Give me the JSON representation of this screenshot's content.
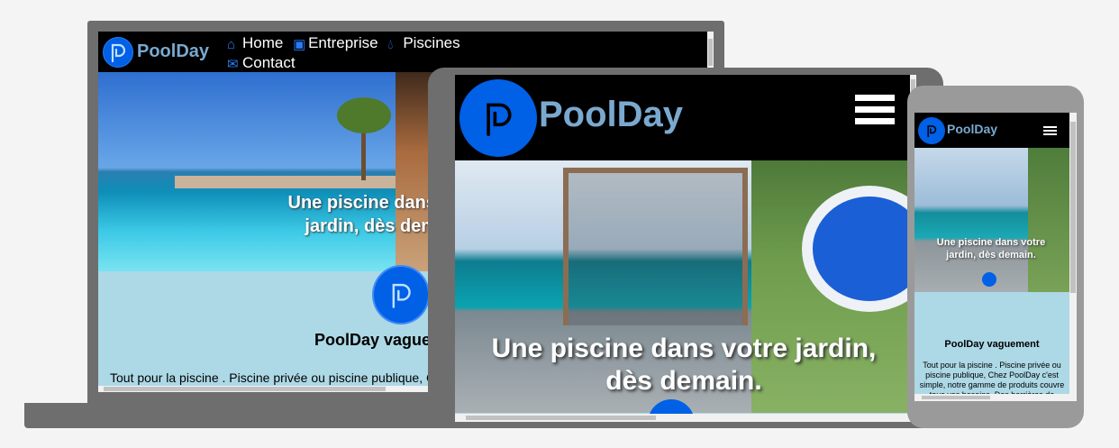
{
  "brand": "PoolDay",
  "nav": {
    "home": "Home",
    "entreprise": "Entreprise",
    "piscines": "Piscines",
    "contact": "Contact"
  },
  "hero": {
    "laptop_text": "Une piscine dans votre jardin, dès demain.",
    "tablet_text": "Une piscine dans votre jardin, dès demain.",
    "phone_text": "Une piscine dans votre jardin, dès demain."
  },
  "section": {
    "heading": "PoolDay vaguement",
    "body": "Tout pour la piscine . Piscine privée ou piscine publique, Chez PoolDay c'est simple, notre gamme de produits couvre tous vos besoins. Des barrières de"
  },
  "colors": {
    "accent_blue": "#0060e6",
    "brand_text": "#7aa9cf",
    "content_bg": "#add8e6",
    "nav_bg": "#000000",
    "device_frame": "#6e6e6e"
  },
  "icons": {
    "home": "home-icon",
    "entreprise": "id-card-icon",
    "piscines": "water-drop-icon",
    "contact": "envelope-icon",
    "menu": "hamburger-menu-icon",
    "logo": "poolday-logo-icon"
  }
}
